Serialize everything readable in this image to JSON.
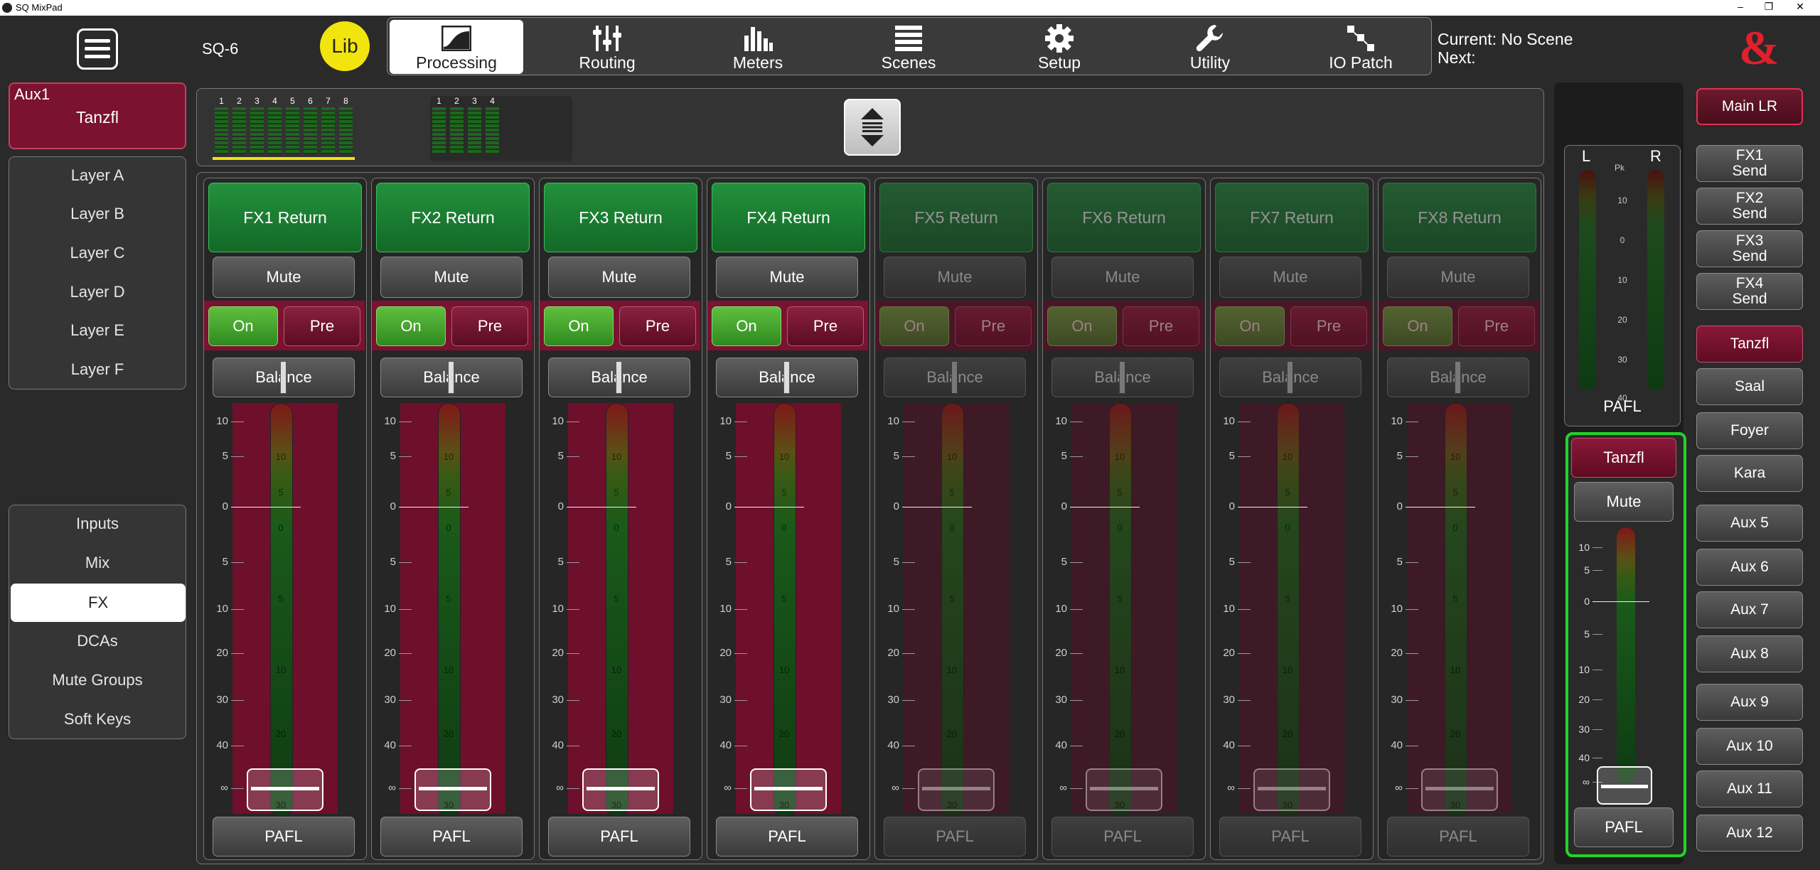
{
  "window": {
    "title": "SQ MixPad",
    "minimize": "–",
    "restore": "❐",
    "close": "✕"
  },
  "header": {
    "device": "SQ-6",
    "lib_label": "Lib",
    "current_label": "Current: No Scene",
    "next_label": "Next:",
    "logo": "&",
    "logo_color": "#e0202c"
  },
  "tabs": [
    {
      "label": "Processing",
      "icon": "processing-icon",
      "active": true
    },
    {
      "label": "Routing",
      "icon": "routing-icon"
    },
    {
      "label": "Meters",
      "icon": "meters-icon"
    },
    {
      "label": "Scenes",
      "icon": "scenes-icon"
    },
    {
      "label": "Setup",
      "icon": "gear-icon"
    },
    {
      "label": "Utility",
      "icon": "wrench-icon"
    },
    {
      "label": "IO Patch",
      "icon": "io-patch-icon"
    }
  ],
  "mix": {
    "label": "Aux1",
    "name": "Tanzfl"
  },
  "layers": [
    "Layer A",
    "Layer B",
    "Layer C",
    "Layer D",
    "Layer E",
    "Layer F"
  ],
  "nav": [
    "Inputs",
    "Mix",
    "FX",
    "DCAs",
    "Mute Groups",
    "Soft Keys"
  ],
  "nav_active": "FX",
  "overview": {
    "group1": [
      "1",
      "2",
      "3",
      "4",
      "5",
      "6",
      "7",
      "8"
    ],
    "group2": [
      "1",
      "2",
      "3",
      "4"
    ]
  },
  "scale": [
    "10",
    "5",
    "0",
    "5",
    "10",
    "20",
    "30",
    "40",
    "∞"
  ],
  "meter_scale": [
    "10",
    "5",
    "0",
    "5",
    "10",
    "20",
    "30"
  ],
  "strips": [
    {
      "name": "FX1 Return",
      "mute": "Mute",
      "on": "On",
      "pre": "Pre",
      "balance": "Balance",
      "pafl": "PAFL",
      "active": true
    },
    {
      "name": "FX2 Return",
      "mute": "Mute",
      "on": "On",
      "pre": "Pre",
      "balance": "Balance",
      "pafl": "PAFL",
      "active": true
    },
    {
      "name": "FX3 Return",
      "mute": "Mute",
      "on": "On",
      "pre": "Pre",
      "balance": "Balance",
      "pafl": "PAFL",
      "active": true
    },
    {
      "name": "FX4 Return",
      "mute": "Mute",
      "on": "On",
      "pre": "Pre",
      "balance": "Balance",
      "pafl": "PAFL",
      "active": true
    },
    {
      "name": "FX5 Return",
      "mute": "Mute",
      "on": "On",
      "pre": "Pre",
      "balance": "Balance",
      "pafl": "PAFL",
      "active": false
    },
    {
      "name": "FX6 Return",
      "mute": "Mute",
      "on": "On",
      "pre": "Pre",
      "balance": "Balance",
      "pafl": "PAFL",
      "active": false
    },
    {
      "name": "FX7 Return",
      "mute": "Mute",
      "on": "On",
      "pre": "Pre",
      "balance": "Balance",
      "pafl": "PAFL",
      "active": false
    },
    {
      "name": "FX8 Return",
      "mute": "Mute",
      "on": "On",
      "pre": "Pre",
      "balance": "Balance",
      "pafl": "PAFL",
      "active": false
    }
  ],
  "master_meter": {
    "left": "L",
    "right": "R",
    "pk": "Pk",
    "scale": [
      "10",
      "0",
      "10",
      "20",
      "30",
      "40"
    ],
    "label": "PAFL"
  },
  "master_strip": {
    "name": "Tanzfl",
    "mute": "Mute",
    "pafl": "PAFL",
    "scale": [
      "10",
      "5",
      "0",
      "5",
      "10",
      "20",
      "30",
      "40",
      "∞"
    ]
  },
  "right_buttons": [
    {
      "label": "Main LR",
      "style": "redout"
    },
    {
      "label": "FX1 Send"
    },
    {
      "label": "FX2 Send"
    },
    {
      "label": "FX3 Send"
    },
    {
      "label": "FX4 Send"
    },
    {
      "label": "Tanzfl",
      "style": "red"
    },
    {
      "label": "Saal"
    },
    {
      "label": "Foyer"
    },
    {
      "label": "Kara"
    },
    {
      "label": "Aux 5"
    },
    {
      "label": "Aux 6"
    },
    {
      "label": "Aux 7"
    },
    {
      "label": "Aux 8"
    },
    {
      "label": "Aux 9"
    },
    {
      "label": "Aux 10"
    },
    {
      "label": "Aux 11"
    },
    {
      "label": "Aux 12"
    }
  ]
}
